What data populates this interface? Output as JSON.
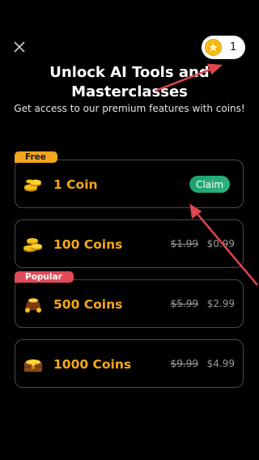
{
  "header": {
    "close_icon": "close-icon",
    "coin_balance": "1",
    "coin_icon": "star-coin-icon"
  },
  "title_line1": "Unlock AI Tools and",
  "title_line2": "Masterclasses",
  "subtitle": "Get access to our premium features with coins!",
  "packages": [
    {
      "badge": "Free",
      "name": "1 Coin",
      "icon": "coin-stack-small-icon",
      "action": "Claim"
    },
    {
      "badge": "",
      "name": "100 Coins",
      "icon": "coin-stack-medium-icon",
      "old_price": "$1.99",
      "price": "$0.99"
    },
    {
      "badge": "Popular",
      "name": "500 Coins",
      "icon": "coin-bag-icon",
      "old_price": "$5.99",
      "price": "$2.99"
    },
    {
      "badge": "",
      "name": "1000 Coins",
      "icon": "treasure-chest-icon",
      "old_price": "$9.99",
      "price": "$4.99"
    }
  ],
  "colors": {
    "background": "#000000",
    "accent_orange": "#f7a817",
    "badge_free": "#f4a61c",
    "badge_popular": "#e14a59",
    "claim_green": "#27a978",
    "annotation_arrow": "#e0474c"
  }
}
